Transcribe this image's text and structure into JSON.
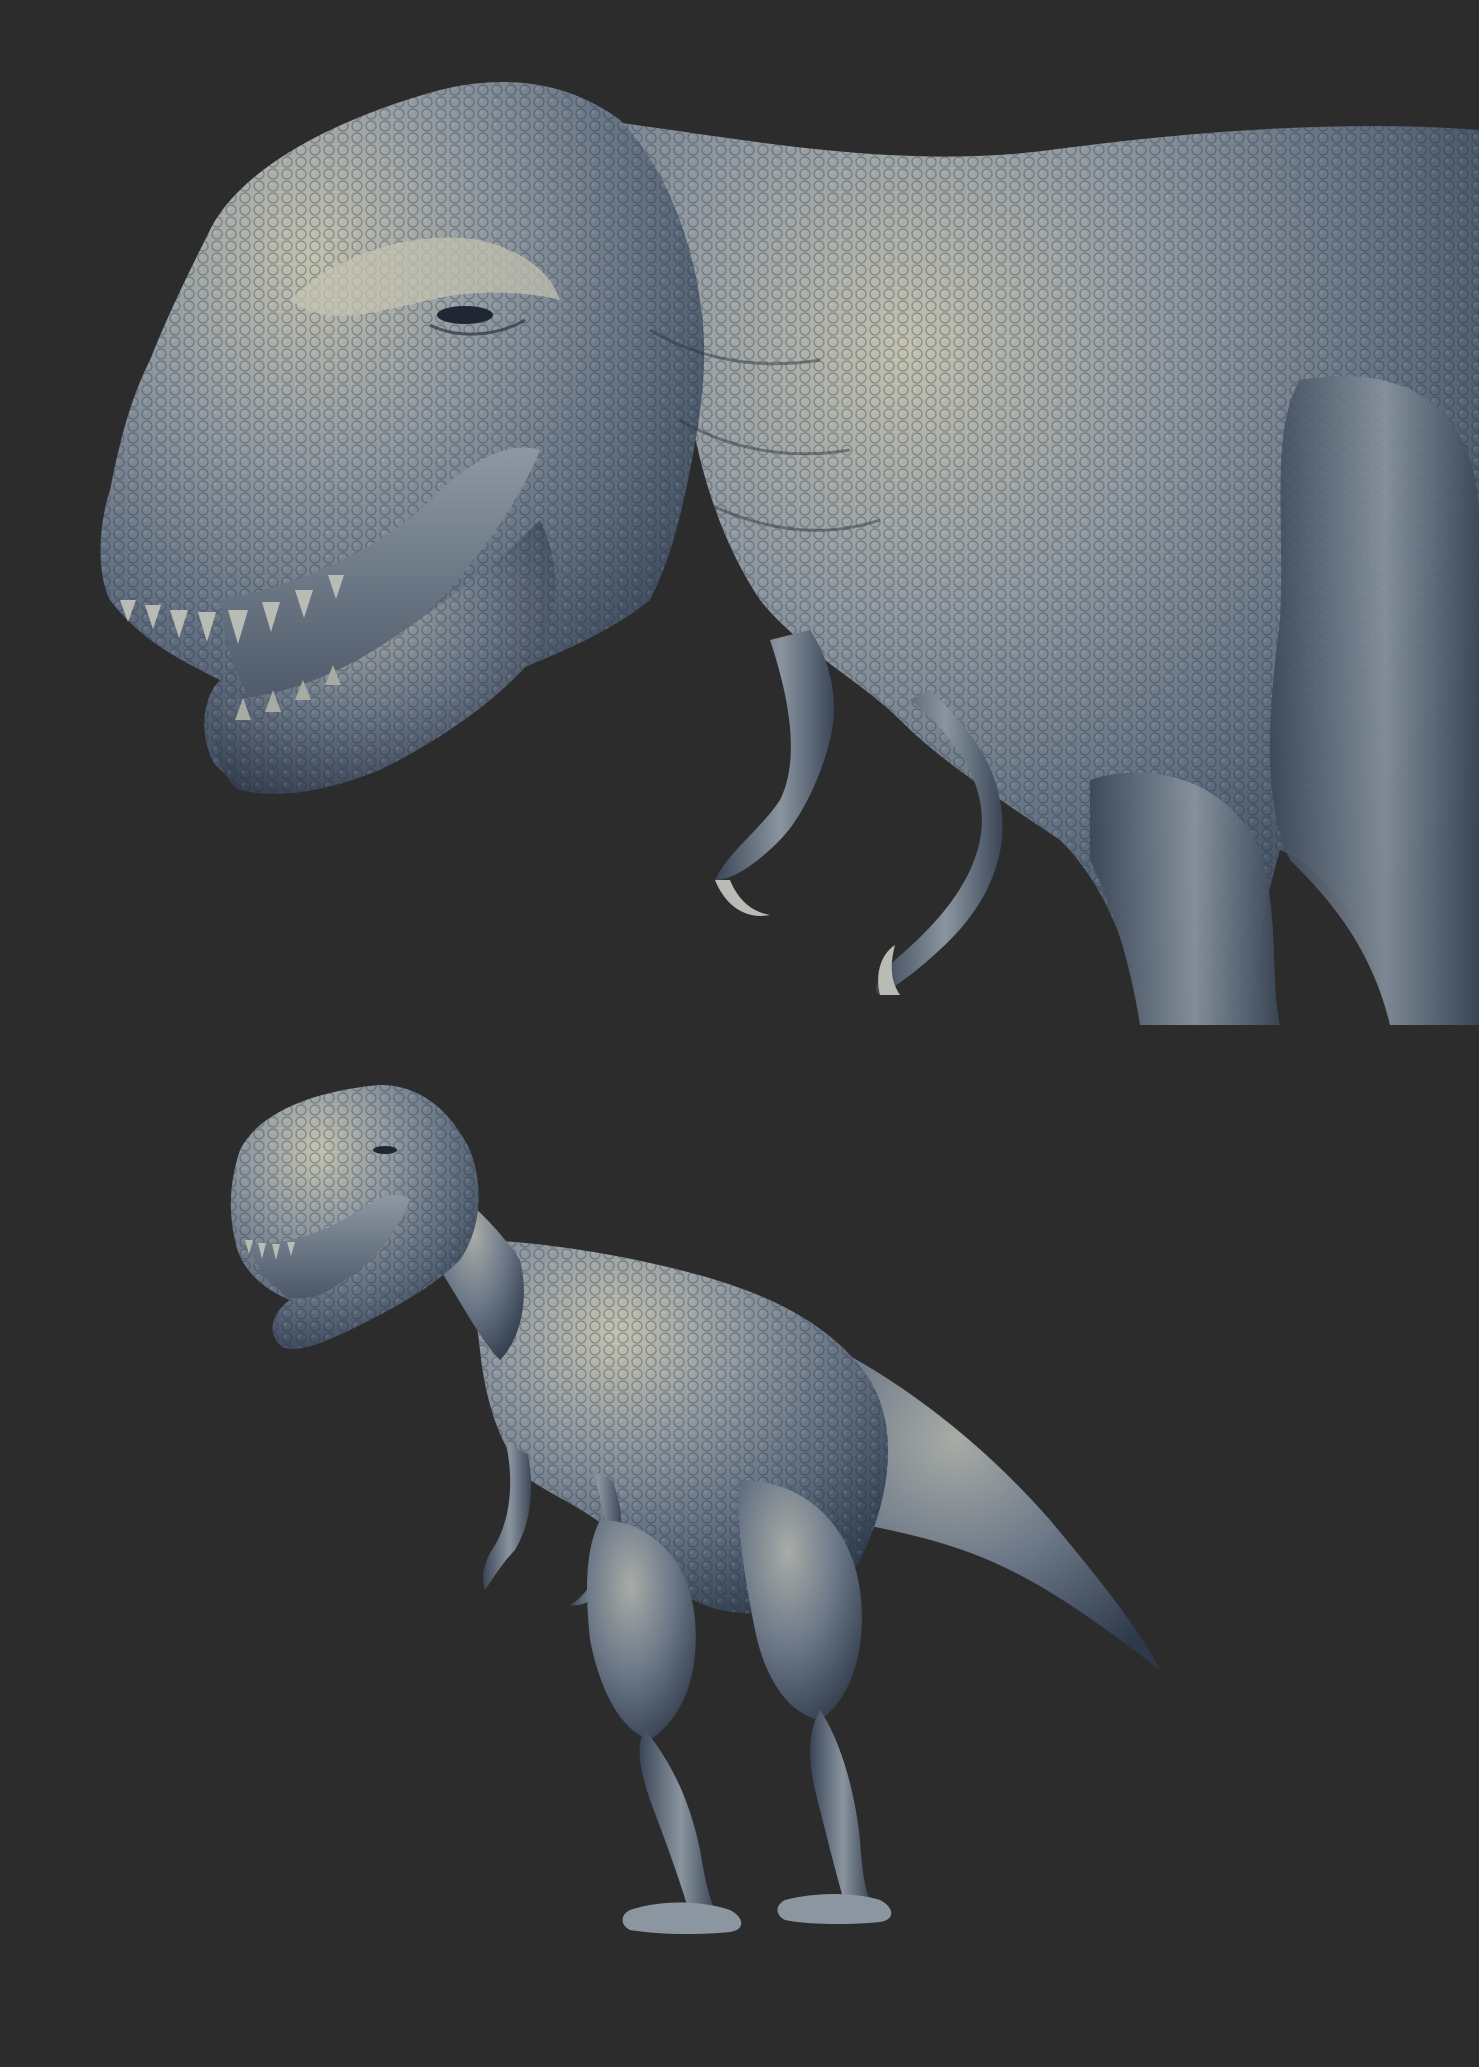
{
  "scene": {
    "background_color": "#2c2c2c",
    "panels": [
      {
        "subject": "t-rex-head-closeup"
      },
      {
        "subject": "t-rex-full-body"
      }
    ]
  },
  "palette": {
    "skin_base": "#5d6b7d",
    "skin_light": "#c3c2b0",
    "skin_shadow": "#243041",
    "mouth_interior": "#7b8795",
    "teeth": "#b9bcb4"
  }
}
